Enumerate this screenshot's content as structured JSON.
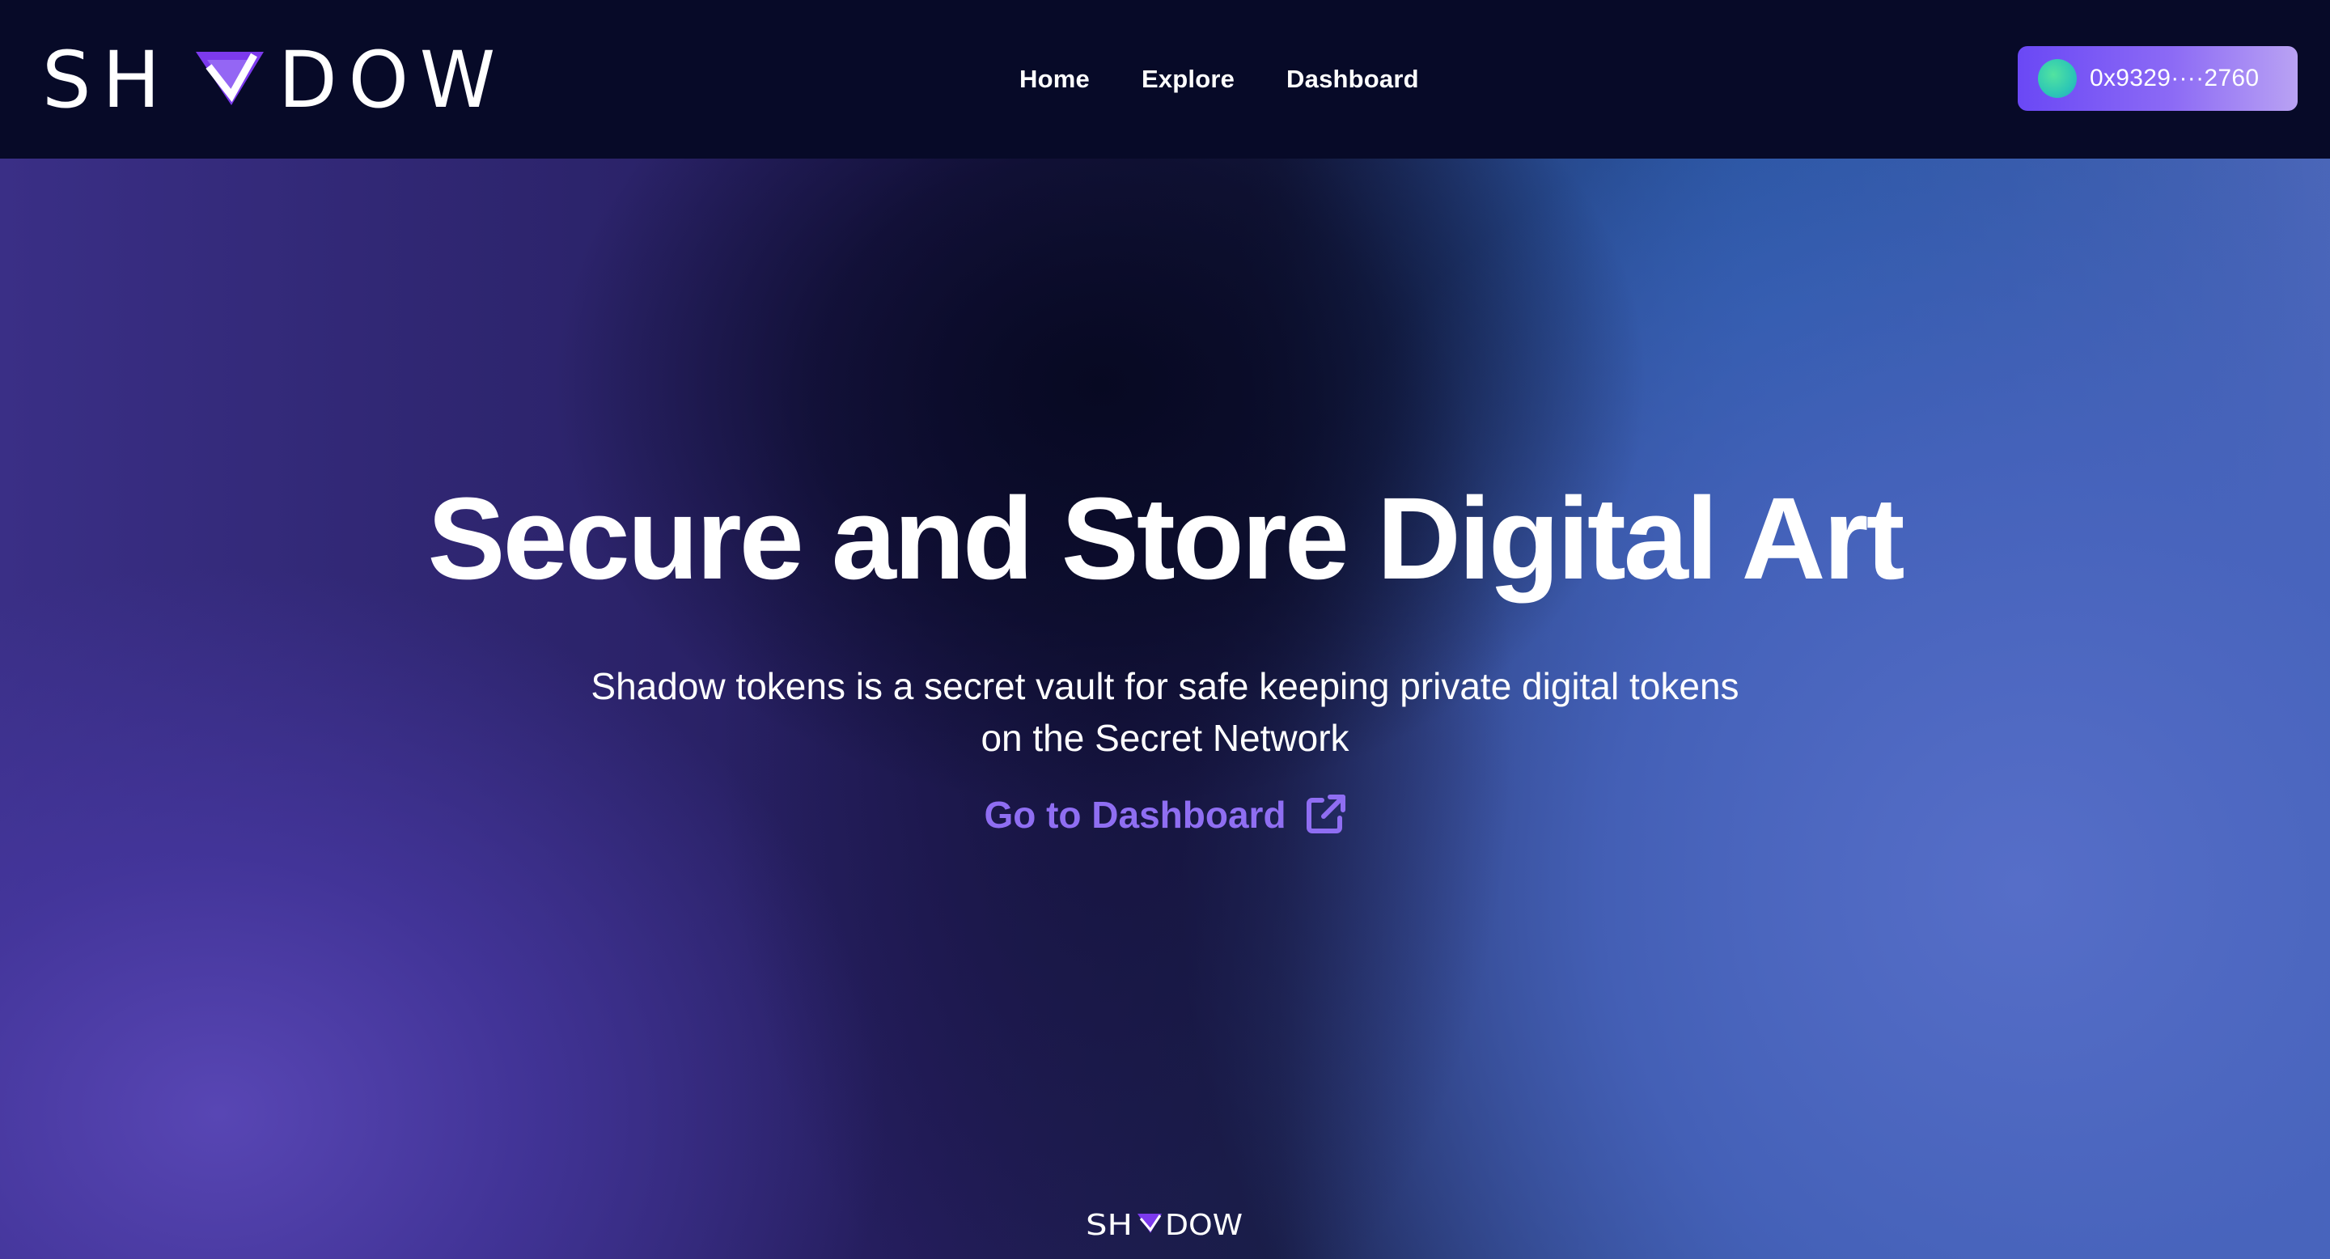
{
  "brand": {
    "name": "SHADOW",
    "logo_left": "SH",
    "logo_right": "DOW",
    "accent_color": "#8b5cf6"
  },
  "nav": {
    "items": [
      {
        "label": "Home"
      },
      {
        "label": "Explore"
      },
      {
        "label": "Dashboard"
      }
    ]
  },
  "wallet": {
    "address": "0x9329····2760",
    "avatar_color": "#34d3a6",
    "button_color": "#7c5cf5"
  },
  "hero": {
    "title": "Secure and Store Digital Art",
    "subtitle_line1": "Shadow tokens is a secret vault for safe keeping private digital tokens",
    "subtitle_line2": "on the Secret Network",
    "cta_label": "Go to Dashboard",
    "cta_icon": "external-link-icon",
    "cta_color": "#8f6ef2"
  },
  "footer": {
    "logo_left": "SH",
    "logo_right": "DOW"
  }
}
